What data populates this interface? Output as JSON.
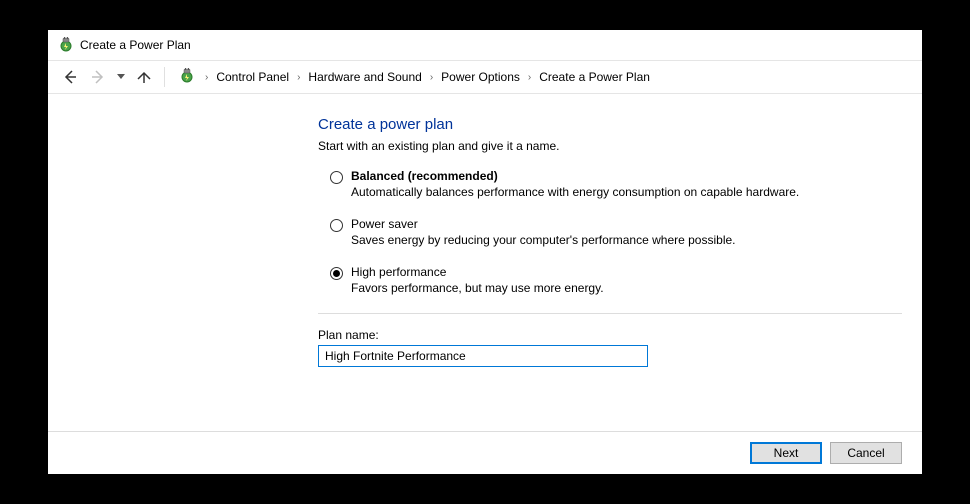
{
  "titlebar": {
    "title": "Create a Power Plan"
  },
  "breadcrumb": {
    "items": [
      "Control Panel",
      "Hardware and Sound",
      "Power Options",
      "Create a Power Plan"
    ]
  },
  "content": {
    "heading": "Create a power plan",
    "subtitle": "Start with an existing plan and give it a name.",
    "plans": [
      {
        "key": "balanced",
        "title": "Balanced (recommended)",
        "desc": "Automatically balances performance with energy consumption on capable hardware.",
        "selected": false,
        "bold": true
      },
      {
        "key": "powersaver",
        "title": "Power saver",
        "desc": "Saves energy by reducing your computer's performance where possible.",
        "selected": false,
        "bold": false
      },
      {
        "key": "highperf",
        "title": "High performance",
        "desc": "Favors performance, but may use more energy.",
        "selected": true,
        "bold": false
      }
    ],
    "plan_name_label": "Plan name:",
    "plan_name_value": "High Fortnite Performance"
  },
  "footer": {
    "next_label": "Next",
    "cancel_label": "Cancel"
  }
}
